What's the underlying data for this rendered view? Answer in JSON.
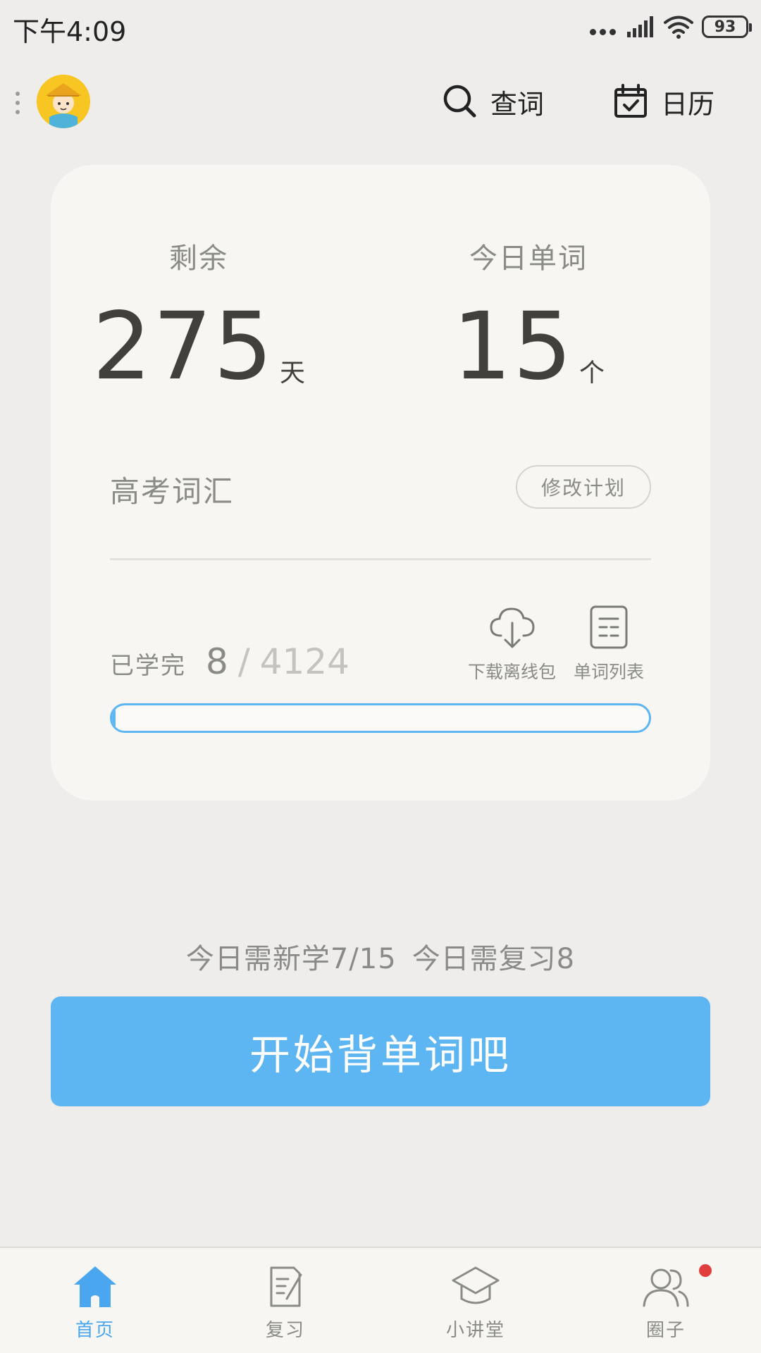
{
  "status_bar": {
    "time": "下午4:09",
    "battery": "93"
  },
  "header": {
    "search_label": "查词",
    "calendar_label": "日历"
  },
  "card": {
    "remaining": {
      "label": "剩余",
      "value": "275",
      "unit": "天"
    },
    "today_words": {
      "label": "今日单词",
      "value": "15",
      "unit": "个"
    },
    "plan_name": "高考词汇",
    "edit_plan_label": "修改计划",
    "learned": {
      "label": "已学完",
      "count": "8",
      "separator": "/",
      "total": "4124"
    },
    "progress_fraction": 0.0019,
    "tools": {
      "download_label": "下载离线包",
      "wordlist_label": "单词列表"
    }
  },
  "tasks": {
    "new_text": "今日需新学7/15",
    "review_text": "今日需复习8"
  },
  "start_button_label": "开始背单词吧",
  "bottom_nav": [
    {
      "label": "首页",
      "icon": "home-icon",
      "active": true
    },
    {
      "label": "复习",
      "icon": "review-icon",
      "active": false
    },
    {
      "label": "小讲堂",
      "icon": "graduation-cap-icon",
      "active": false
    },
    {
      "label": "圈子",
      "icon": "people-icon",
      "active": false,
      "has_badge": true
    }
  ],
  "colors": {
    "accent": "#5db5f2",
    "nav_active": "#4aa7ef",
    "badge": "#e23d3d",
    "background": "#eeedeb",
    "card": "#f7f6f3"
  }
}
